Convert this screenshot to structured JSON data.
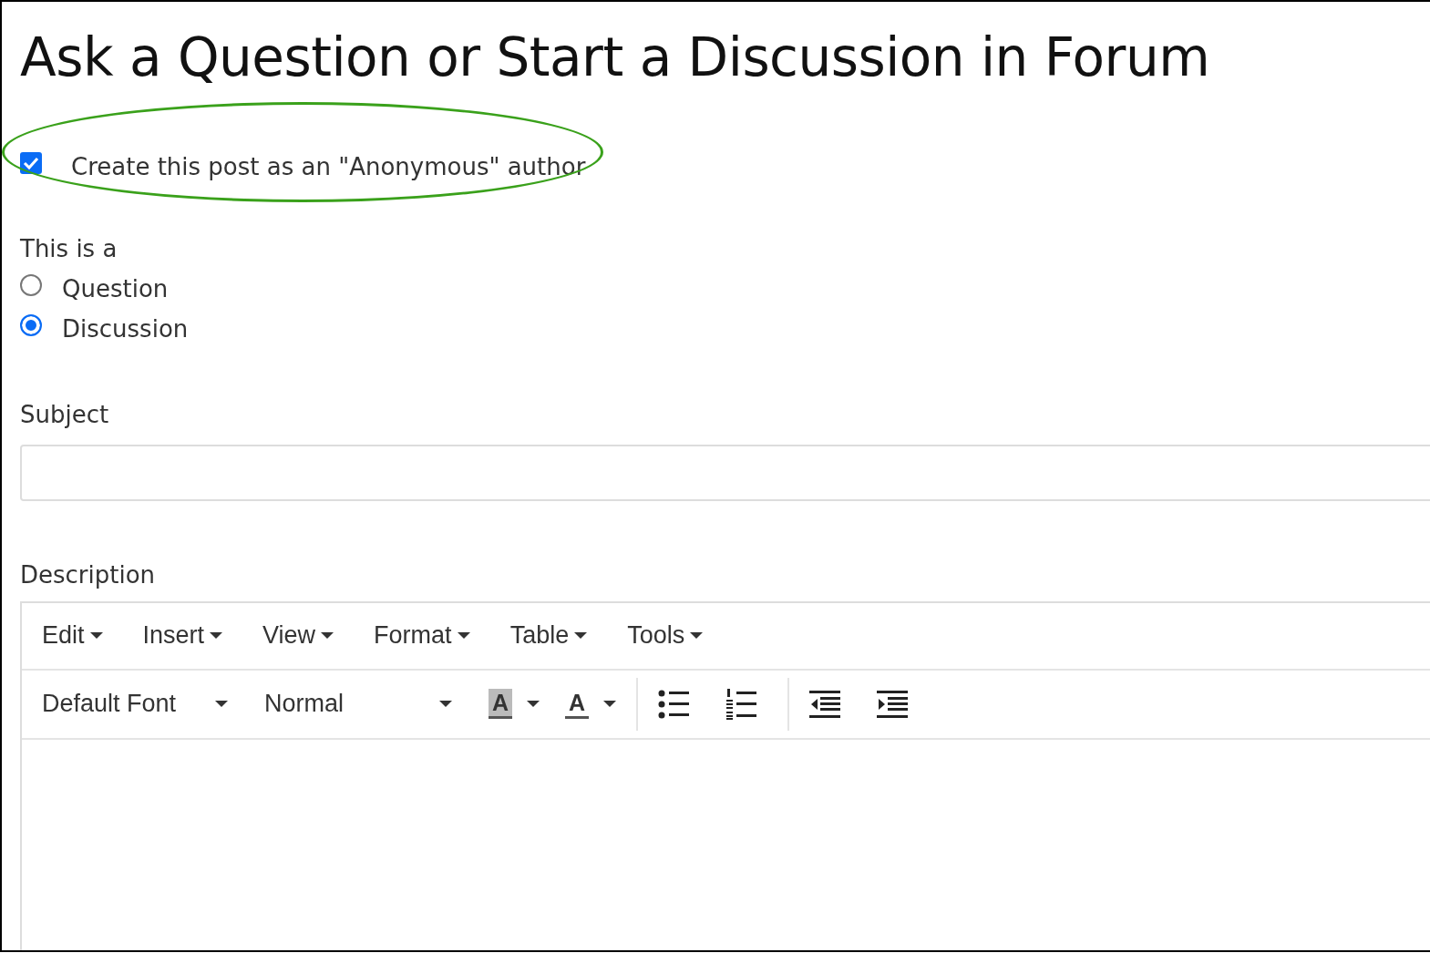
{
  "page": {
    "title": "Ask a Question or Start a Discussion in Forum"
  },
  "anonymous": {
    "label": "Create this post as an \"Anonymous\" author",
    "checked": true,
    "circled": true
  },
  "post_type": {
    "label": "This is a",
    "options": [
      {
        "label": "Question",
        "selected": false
      },
      {
        "label": "Discussion",
        "selected": true
      }
    ]
  },
  "subject": {
    "label": "Subject"
  },
  "description": {
    "label": "Description",
    "menus": [
      {
        "label": "Edit"
      },
      {
        "label": "Insert"
      },
      {
        "label": "View"
      },
      {
        "label": "Format"
      },
      {
        "label": "Table"
      },
      {
        "label": "Tools"
      }
    ],
    "toolbar": [
      {
        "kind": "dropdown",
        "label": "Default Font"
      },
      {
        "kind": "dropdown",
        "label": "Normal"
      },
      {
        "kind": "highlight",
        "label": "A"
      },
      {
        "kind": "text-color",
        "label": "A"
      },
      {
        "kind": "separator"
      },
      {
        "kind": "bullet-list"
      },
      {
        "kind": "numbered-list"
      },
      {
        "kind": "separator"
      },
      {
        "kind": "outdent"
      },
      {
        "kind": "indent"
      }
    ]
  }
}
